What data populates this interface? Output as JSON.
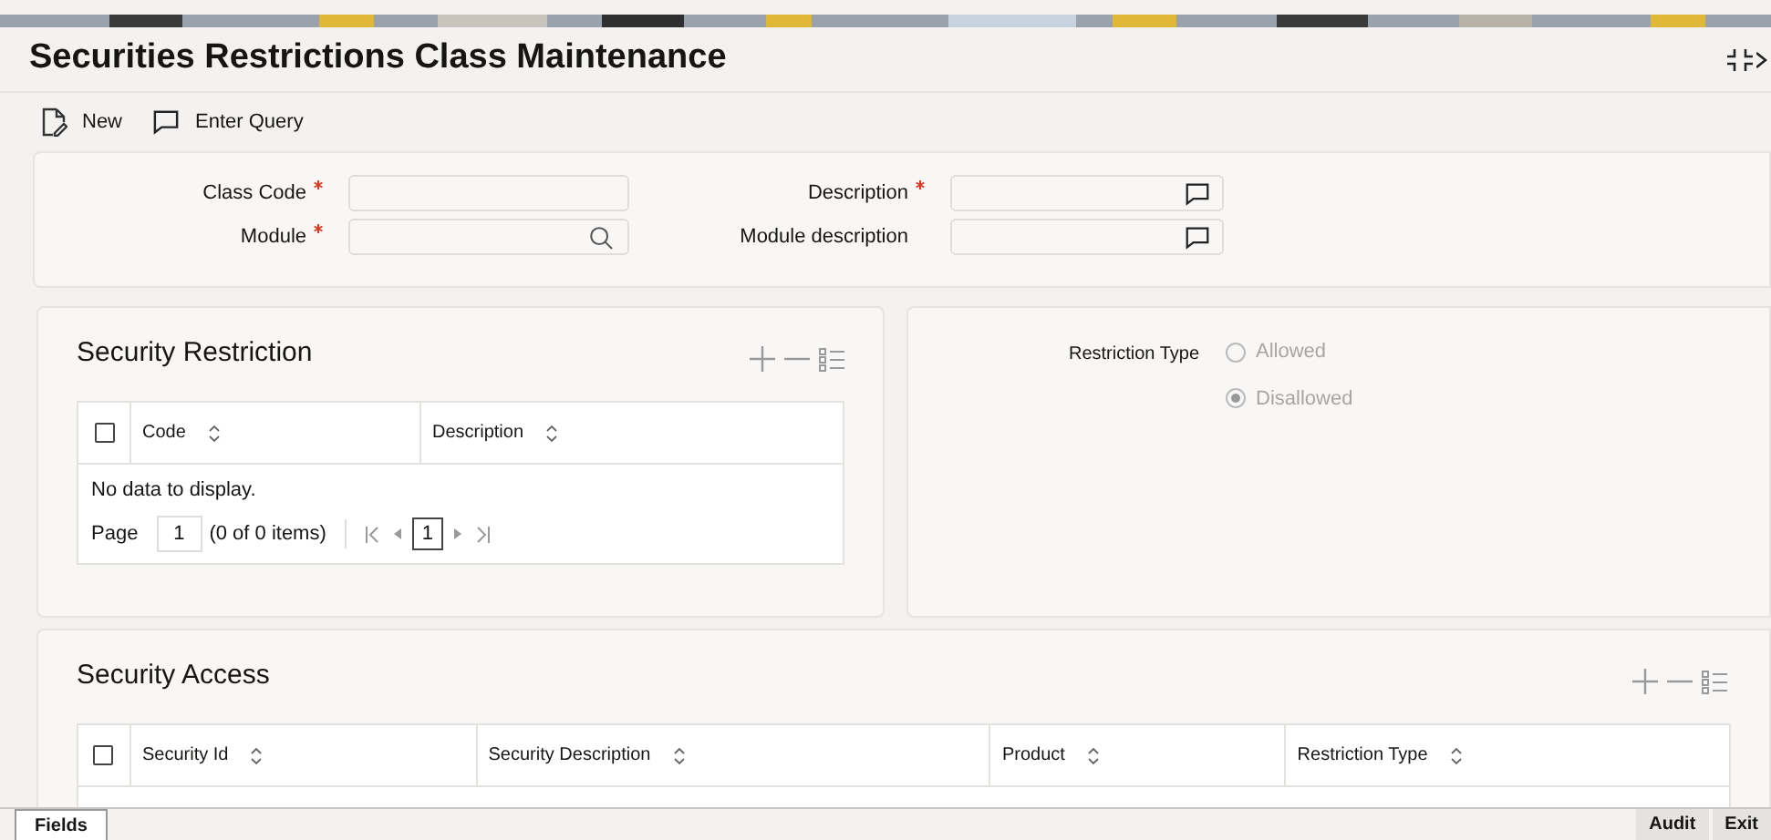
{
  "header": {
    "title": "Securities Restrictions Class Maintenance"
  },
  "toolbar": [
    {
      "kind": "new",
      "label": "New"
    },
    {
      "kind": "query",
      "label": "Enter Query"
    }
  ],
  "form": {
    "fields": [
      {
        "label": "Class Code",
        "required": true,
        "kind": "text"
      },
      {
        "label": "Description",
        "required": true,
        "kind": "note"
      },
      {
        "label": "Module",
        "required": true,
        "kind": "search"
      },
      {
        "label": "Module description",
        "required": false,
        "kind": "note"
      }
    ]
  },
  "security_restriction": {
    "title": "Security Restriction",
    "all_checked": false,
    "columns": [
      {
        "label": "Code"
      },
      {
        "label": "Description"
      }
    ],
    "empty_message": "No data to display.",
    "pager": {
      "label": "Page",
      "page": "1",
      "summary": "(0 of 0 items)",
      "current": "1"
    }
  },
  "restriction_type": {
    "label": "Restriction Type",
    "disabled": true,
    "options": [
      {
        "label": "Allowed",
        "selected": false
      },
      {
        "label": "Disallowed",
        "selected": true
      }
    ]
  },
  "security_access": {
    "title": "Security Access",
    "all_checked": false,
    "columns": [
      {
        "label": "Security Id"
      },
      {
        "label": "Security Description"
      },
      {
        "label": "Product"
      },
      {
        "label": "Restriction Type"
      }
    ]
  },
  "footer": {
    "left": [
      "Fields"
    ],
    "right": [
      "Audit",
      "Exit"
    ]
  }
}
